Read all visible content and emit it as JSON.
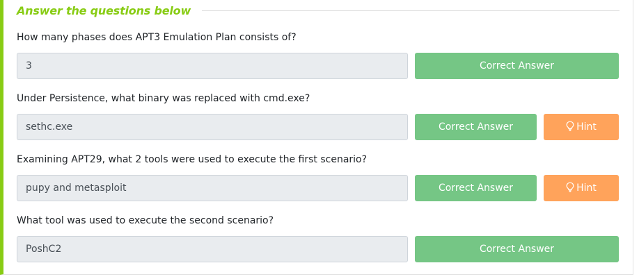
{
  "section": {
    "title": "Answer the questions below"
  },
  "questions": [
    {
      "question": "How many phases does APT3 Emulation Plan consists of?",
      "answer": "3",
      "button_label": "Correct Answer",
      "hint_label": null
    },
    {
      "question": "Under Persistence, what binary was replaced with cmd.exe?",
      "answer": "sethc.exe",
      "button_label": "Correct Answer",
      "hint_label": "Hint"
    },
    {
      "question": "Examining APT29, what 2 tools were used to execute the first scenario?",
      "answer": "pupy and metasploit",
      "button_label": "Correct Answer",
      "hint_label": "Hint"
    },
    {
      "question": "What tool was used to execute the second scenario?",
      "answer": "PoshC2",
      "button_label": "Correct Answer",
      "hint_label": null
    }
  ],
  "icons": {
    "hint": "lightbulb-icon"
  },
  "colors": {
    "accent": "#88cc14",
    "correct": "#75c685",
    "hint": "#ffa35b",
    "input_bg": "#e9ecef"
  }
}
